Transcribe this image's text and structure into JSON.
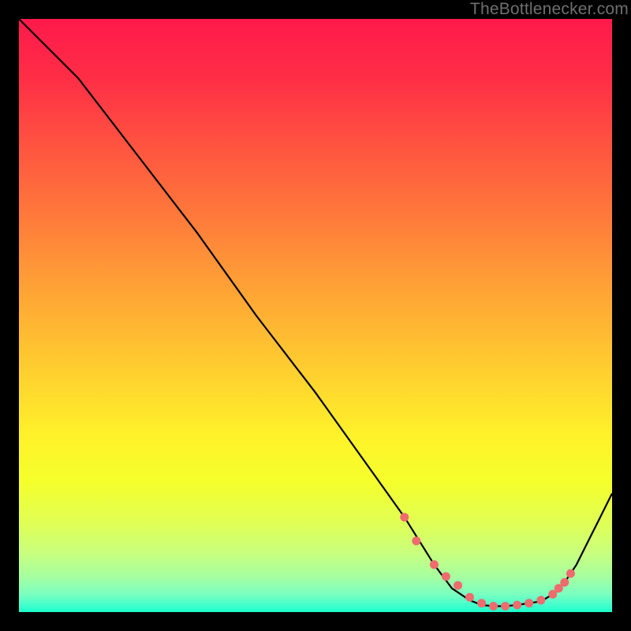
{
  "watermark_text": "TheBottlenecker.com",
  "gradient_stops": [
    {
      "offset": 0.0,
      "color": "#ff194b"
    },
    {
      "offset": 0.1,
      "color": "#ff2e46"
    },
    {
      "offset": 0.2,
      "color": "#ff4f41"
    },
    {
      "offset": 0.3,
      "color": "#ff6f3c"
    },
    {
      "offset": 0.4,
      "color": "#ff9038"
    },
    {
      "offset": 0.5,
      "color": "#ffb133"
    },
    {
      "offset": 0.6,
      "color": "#ffd12f"
    },
    {
      "offset": 0.7,
      "color": "#fff12a"
    },
    {
      "offset": 0.78,
      "color": "#f5ff2b"
    },
    {
      "offset": 0.85,
      "color": "#e0ff55"
    },
    {
      "offset": 0.9,
      "color": "#c9ff7e"
    },
    {
      "offset": 0.94,
      "color": "#a7ffa0"
    },
    {
      "offset": 0.97,
      "color": "#7affc0"
    },
    {
      "offset": 0.99,
      "color": "#3effce"
    },
    {
      "offset": 1.0,
      "color": "#1affc8"
    }
  ],
  "curve_color": "#000000",
  "marker_color": "#ee6b6e",
  "chart_data": {
    "type": "line",
    "title": "",
    "xlabel": "",
    "ylabel": "",
    "xlim": [
      0,
      100
    ],
    "ylim": [
      0,
      100
    ],
    "note": "No axes, ticks, or numeric labels are rendered in the source image; x/y values are pixel-derived estimates on a 0–100 normalized range.",
    "series": [
      {
        "name": "bottleneck-curve",
        "x": [
          0,
          6,
          10,
          20,
          30,
          40,
          50,
          60,
          65,
          70,
          73,
          76,
          78,
          80,
          82,
          84,
          86,
          88,
          90,
          92,
          94,
          96,
          98,
          100
        ],
        "y": [
          100,
          94,
          90,
          77,
          64,
          50,
          37,
          23,
          16,
          8,
          4,
          2,
          1.2,
          1,
          1,
          1.2,
          1.5,
          1.8,
          3,
          5,
          8,
          12,
          16,
          20
        ]
      }
    ],
    "markers": {
      "name": "highlight-range",
      "x": [
        65,
        67,
        70,
        72,
        74,
        76,
        78,
        80,
        82,
        84,
        86,
        88,
        90,
        91,
        92,
        93
      ],
      "y": [
        16,
        12,
        8,
        6,
        4.5,
        2.5,
        1.5,
        1,
        1,
        1.2,
        1.5,
        2,
        3,
        4,
        5,
        6.5
      ]
    }
  }
}
